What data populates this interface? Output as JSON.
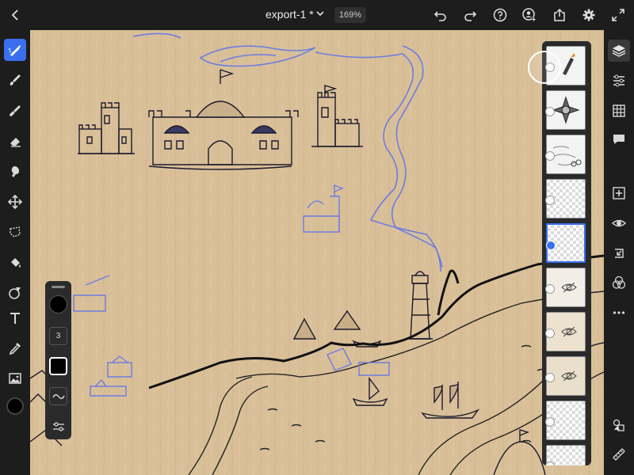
{
  "topbar": {
    "back_icon": "chevron-left-icon",
    "title": "export-1 *",
    "zoom": "169%",
    "actions": [
      "undo-icon",
      "redo-icon",
      "help-icon",
      "share-user-icon",
      "export-icon",
      "settings-icon",
      "fullscreen-icon"
    ]
  },
  "left_tools": [
    "pixel-brush-icon",
    "paint-brush-icon",
    "vector-brush-icon",
    "eraser-icon",
    "smudge-icon",
    "move-icon",
    "lasso-select-icon",
    "fill-icon",
    "shape-icon",
    "text-icon",
    "eyedropper-icon",
    "place-image-icon"
  ],
  "current_color": "#000000",
  "brush_panel": {
    "size": "3",
    "color": "#000000"
  },
  "right_tools": [
    "layers-icon",
    "properties-icon",
    "grid-icon",
    "comments-icon",
    "add-layer-icon",
    "visibility-icon",
    "import-icon",
    "blend-icon",
    "more-icon",
    "masks-icon",
    "ruler-icon"
  ],
  "layers": [
    {
      "type": "thumb-brush",
      "hidden": false
    },
    {
      "type": "thumb-compass",
      "hidden": false
    },
    {
      "type": "thumb-sketch",
      "hidden": false
    },
    {
      "type": "checker",
      "hidden": false
    },
    {
      "type": "empty-selected",
      "hidden": false
    },
    {
      "type": "thumb-plain",
      "hidden": true
    },
    {
      "type": "thumb-plain",
      "hidden": true
    },
    {
      "type": "thumb-plain",
      "hidden": true
    },
    {
      "type": "checker",
      "hidden": false
    },
    {
      "type": "checker",
      "hidden": false
    }
  ],
  "colors": {
    "accent": "#3a6ff0",
    "canvas": "#d9bf98",
    "sketch_blue": "#6c7de0"
  }
}
